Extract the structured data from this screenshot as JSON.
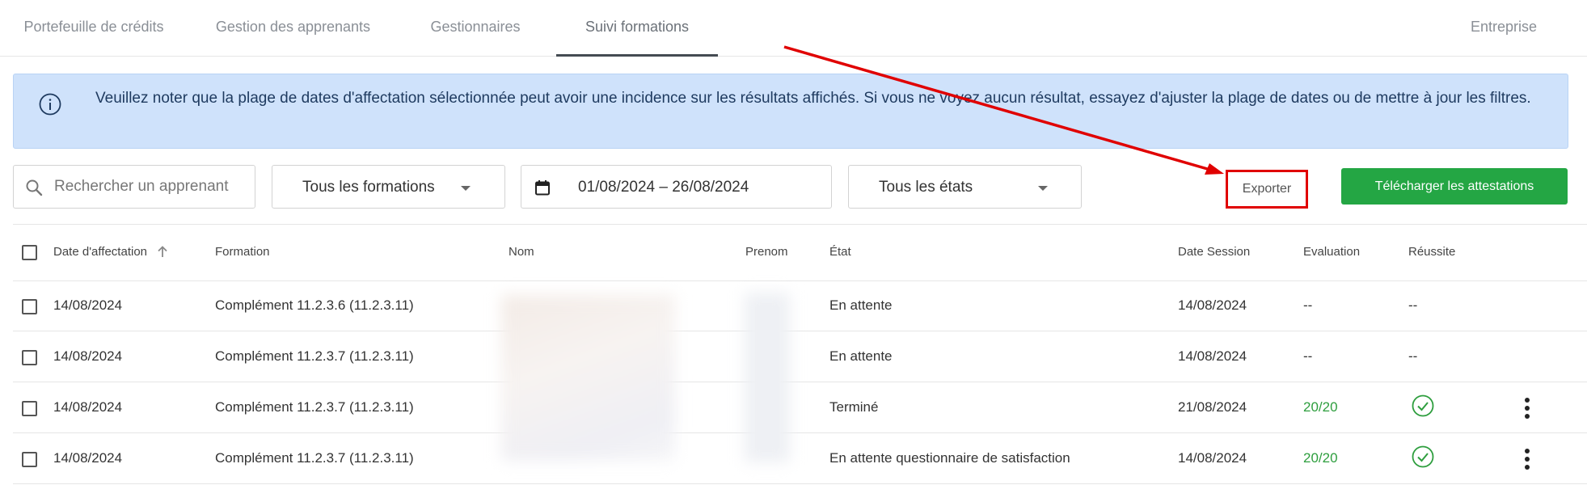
{
  "tabs": [
    {
      "label": "Portefeuille de crédits"
    },
    {
      "label": "Gestion des apprenants"
    },
    {
      "label": "Gestionnaires"
    },
    {
      "label": "Suivi formations"
    },
    {
      "label": "Entreprise"
    }
  ],
  "active_tab": "Suivi formations",
  "banner": {
    "icon": "info-icon",
    "message": "Veuillez noter que la plage de dates d'affectation sélectionnée peut avoir une incidence sur les résultats affichés. Si vous ne voyez aucun résultat, essayez d'ajuster la plage de dates ou de mettre à jour les filtres."
  },
  "filters": {
    "search_placeholder": "Rechercher un apprenant",
    "formation_selected": "Tous les formations",
    "date_range": "01/08/2024 – 26/08/2024",
    "etat_selected": "Tous les états"
  },
  "actions": {
    "export_label": "Exporter",
    "download_label": "Télécharger les attestations"
  },
  "table": {
    "headers": {
      "date_affectation": "Date d'affectation",
      "formation": "Formation",
      "nom": "Nom",
      "prenom": "Prenom",
      "etat": "État",
      "date_session": "Date Session",
      "evaluation": "Evaluation",
      "reussite": "Réussite"
    },
    "rows": [
      {
        "date_affectation": "14/08/2024",
        "formation": "Complément 11.2.3.6 (11.2.3.11)",
        "etat": "En attente",
        "date_session": "14/08/2024",
        "evaluation": "--",
        "reussite": "--",
        "passed": false
      },
      {
        "date_affectation": "14/08/2024",
        "formation": "Complément 11.2.3.7 (11.2.3.11)",
        "etat": "En attente",
        "date_session": "14/08/2024",
        "evaluation": "--",
        "reussite": "--",
        "passed": false
      },
      {
        "date_affectation": "14/08/2024",
        "formation": "Complément 11.2.3.7 (11.2.3.11)",
        "etat": "Terminé",
        "date_session": "21/08/2024",
        "evaluation": "20/20",
        "reussite": "",
        "passed": true
      },
      {
        "date_affectation": "14/08/2024",
        "formation": "Complément 11.2.3.7 (11.2.3.11)",
        "etat": "En attente questionnaire de satisfaction",
        "date_session": "14/08/2024",
        "evaluation": "20/20",
        "reussite": "",
        "passed": true
      }
    ]
  },
  "colors": {
    "banner_bg": "#cfe2fb",
    "download_button": "#24a644",
    "success": "#2e9e3e",
    "annotation": "#e00000"
  }
}
